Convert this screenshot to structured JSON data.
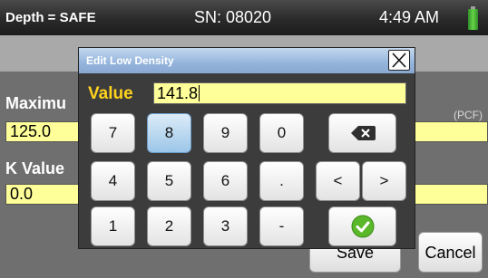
{
  "status": {
    "depth": "Depth = SAFE",
    "serial": "SN: 08020",
    "time": "4:49 AM",
    "battery_icon": "battery-icon"
  },
  "form": {
    "max_label": "Maximu",
    "max_value": "125.0",
    "k_label": "K Value",
    "k_value": "0.0",
    "unit": "(PCF)"
  },
  "footer": {
    "save": "Save",
    "cancel": "Cancel"
  },
  "dialog": {
    "title": "Edit Low Density",
    "value_label": "Value",
    "value": "141.8",
    "keys": {
      "k7": "7",
      "k8": "8",
      "k9": "9",
      "k0": "0",
      "k4": "4",
      "k5": "5",
      "k6": "6",
      "dot": ".",
      "k1": "1",
      "k2": "2",
      "k3": "3",
      "minus": "-",
      "left": "<",
      "right": ">"
    },
    "icons": {
      "close": "close-icon",
      "backspace": "backspace-icon",
      "confirm": "check-icon"
    }
  },
  "colors": {
    "field_bg": "#ffff99",
    "value_label": "#ffd21c",
    "titlebar": "#94b4dc",
    "confirm": "#5bb82a"
  }
}
